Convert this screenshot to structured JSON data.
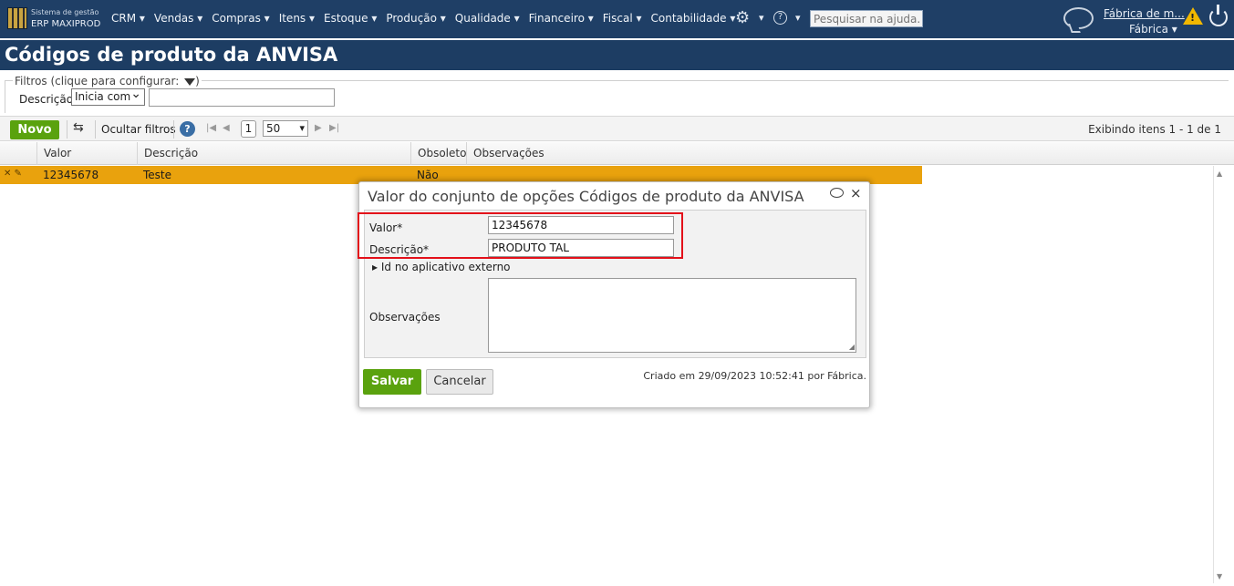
{
  "app": {
    "brand_line1": "Sistema de gestão",
    "brand_line2": "ERP MAXIPROD",
    "menu": [
      "CRM",
      "Vendas",
      "Compras",
      "Itens",
      "Estoque",
      "Produção",
      "Qualidade",
      "Financeiro",
      "Fiscal",
      "Contabilidade"
    ],
    "search_placeholder": "Pesquisar na ajuda...",
    "company_name": "Fábrica de m...",
    "company_sub": "Fábrica ▾",
    "warning_symbol": "!",
    "help_symbol": "?"
  },
  "page": {
    "title": "Códigos de produto da ANVISA"
  },
  "filters": {
    "legend": "Filtros (clique para configurar:",
    "legend_close": ")",
    "description_label": "Descrição",
    "mode_value": "Inicia com",
    "text_value": ""
  },
  "toolbar": {
    "new_label": "Novo",
    "hide_filters_label": "Ocultar filtros",
    "help_symbol": "?",
    "page_value": "1",
    "page_size": "50",
    "showing_label": "Exibindo itens 1 - 1 de 1"
  },
  "grid": {
    "columns": [
      "Valor",
      "Descrição",
      "Obsoleto",
      "Observações"
    ],
    "rows": [
      {
        "valor": "12345678",
        "descricao": "Teste",
        "obsoleto": "Não",
        "observacoes": ""
      }
    ]
  },
  "modal": {
    "title": "Valor do conjunto de opções Códigos de produto da ANVISA",
    "close_symbol": "×",
    "valor_label": "Valor*",
    "valor_value": "12345678",
    "descricao_label": "Descrição*",
    "descricao_value": "PRODUTO TAL",
    "external_id_label": "Id no aplicativo externo",
    "observacoes_label": "Observações",
    "observacoes_value": "",
    "save_label": "Salvar",
    "cancel_label": "Cancelar",
    "created_text": "Criado em 29/09/2023 10:52:41 por Fábrica."
  },
  "colors": {
    "nav_bg": "#1f3f66",
    "selected_row": "#e9a20d",
    "primary_button": "#5aa20e",
    "highlight_border": "#e3101a"
  },
  "icons": [
    "logo-icon",
    "gear-icon",
    "help-icon",
    "chat-icon",
    "warning-icon",
    "power-icon",
    "funnel-icon",
    "refresh-icon",
    "close-icon"
  ]
}
